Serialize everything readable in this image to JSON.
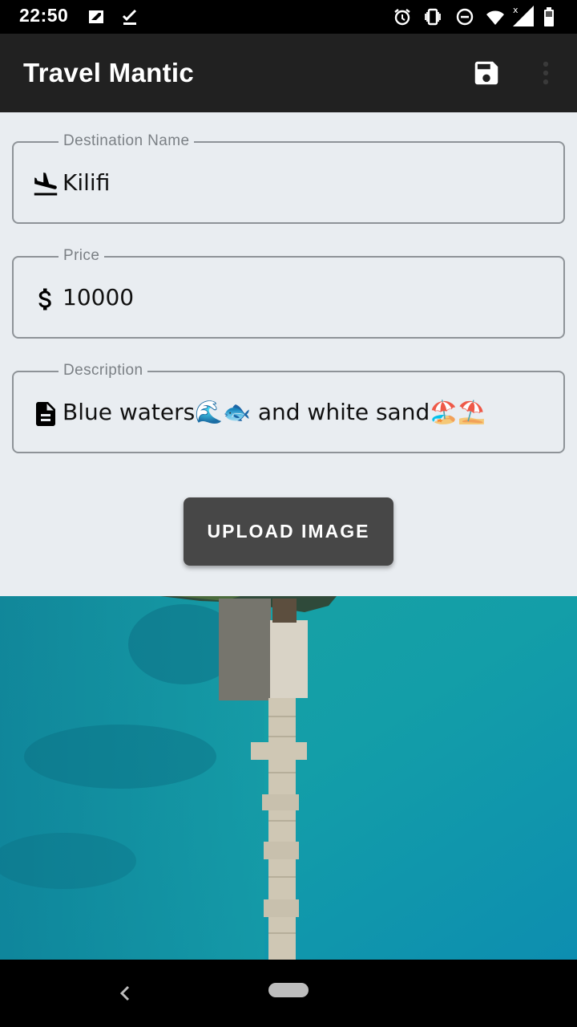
{
  "status_bar": {
    "time": "22:50",
    "left_icons": [
      "sim-card-icon",
      "checkmark-download-icon"
    ],
    "right_icons": [
      "alarm-icon",
      "vibrate-icon",
      "do-not-disturb-icon",
      "wifi-icon",
      "cellular-signal-icon",
      "battery-icon"
    ]
  },
  "app_bar": {
    "title": "Travel Mantic",
    "actions": [
      "save-icon",
      "more-options-icon"
    ]
  },
  "form": {
    "destination": {
      "label": "Destination Name",
      "value": "Kilifi",
      "icon": "flight-land-icon"
    },
    "price": {
      "label": "Price",
      "value": "10000",
      "icon": "dollar-icon"
    },
    "description": {
      "label": "Description",
      "value": "Blue waters🌊🐟 and white sand🏖️⛱️",
      "icon": "document-icon"
    }
  },
  "upload_button": {
    "label": "UPLOAD IMAGE"
  },
  "image": {
    "subject": "aerial-pier-over-turquoise-water"
  },
  "colors": {
    "app_bar": "#212121",
    "background": "#e9edf1",
    "button": "#474747",
    "outline": "#8e9398"
  }
}
